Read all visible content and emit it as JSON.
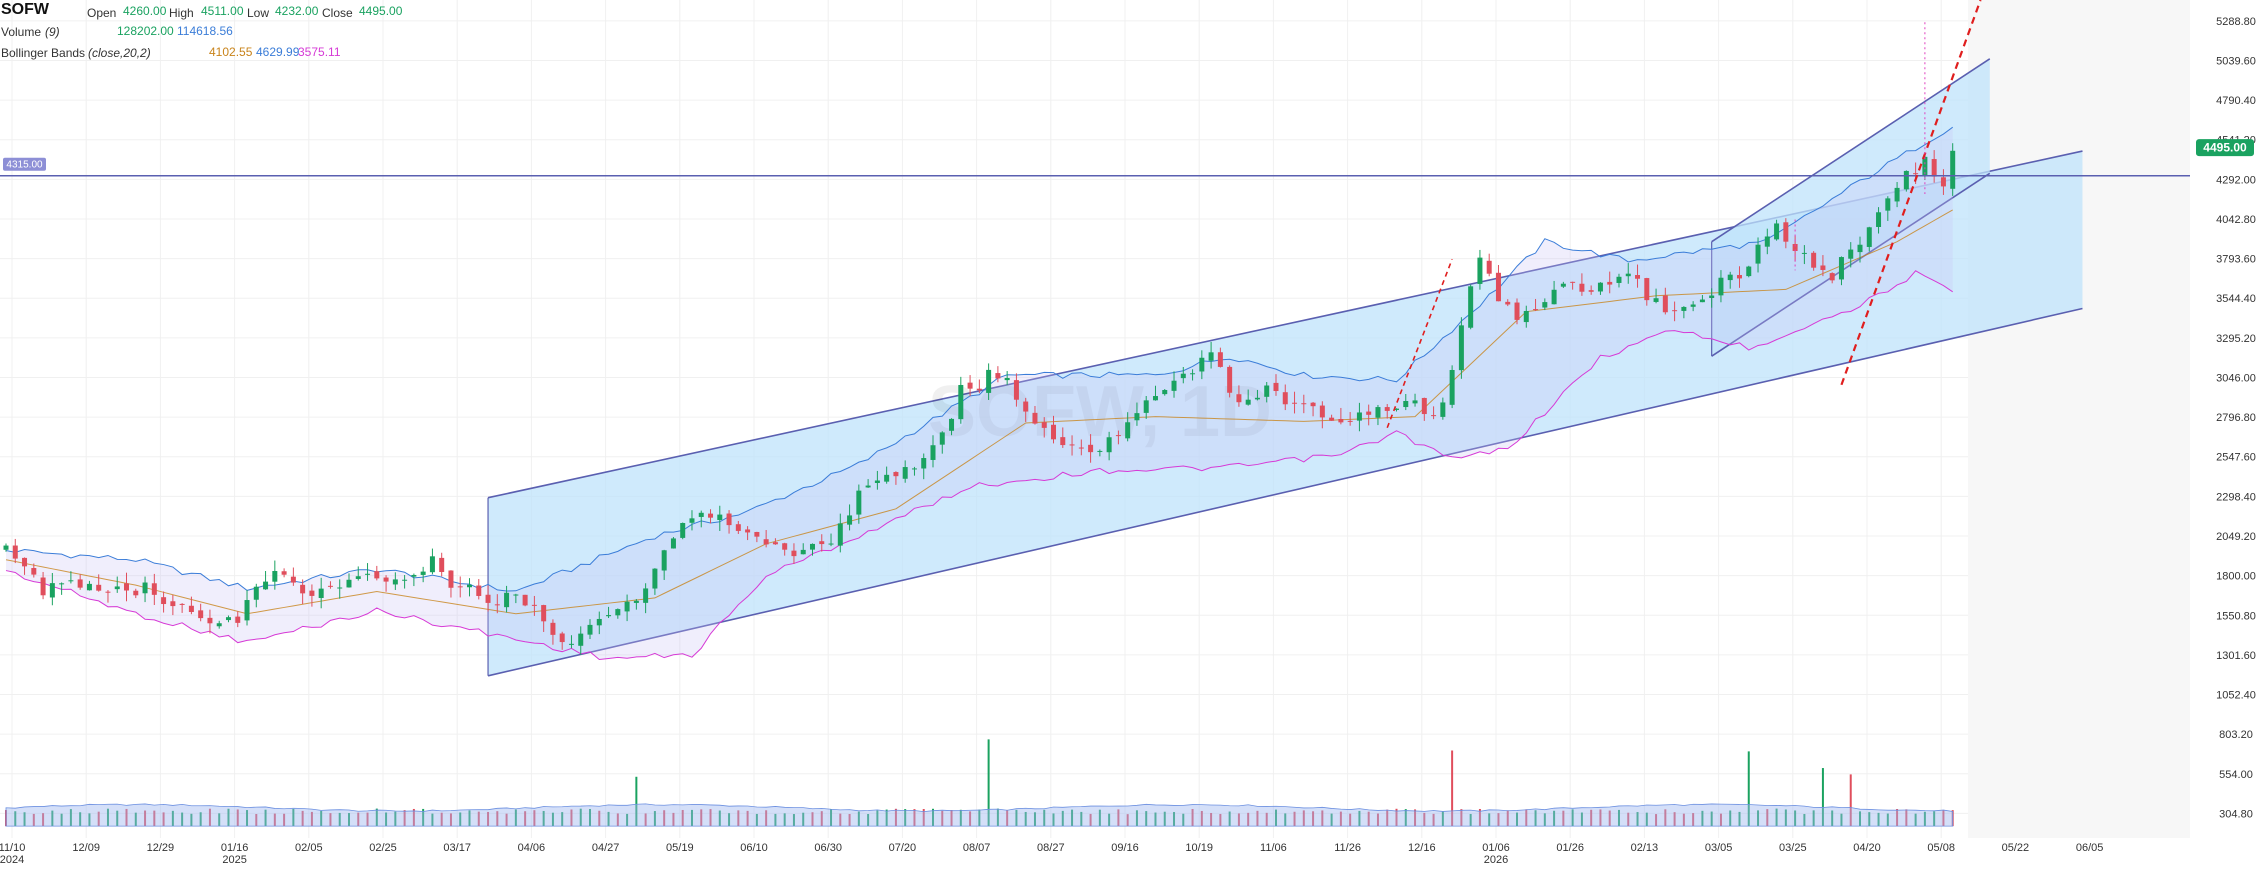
{
  "symbol": "SOFW",
  "ohlc": {
    "open_label": "Open",
    "open": "4260.00",
    "high_label": "High",
    "high": "4511.00",
    "low_label": "Low",
    "low": "4232.00",
    "close_label": "Close",
    "close": "4495.00"
  },
  "volume_legend": {
    "label": "Volume",
    "period": "(9)",
    "value": "128202.00",
    "ma": "114618.56"
  },
  "bb_legend": {
    "label": "Bollinger Bands",
    "params": "(close,20,2)",
    "basis": "4102.55",
    "upper": "4629.99",
    "lower": "3575.11"
  },
  "watermark": "SOFW, 1D",
  "left_price_tag": "4315.00",
  "last_price_tag": "4495.00",
  "colors": {
    "up": "#1aa260",
    "down": "#e04e5c",
    "grid": "#f0f0f0",
    "bb_upper": "#3b7dd8",
    "bb_lower": "#d63ad6",
    "bb_basis": "#c8831a",
    "channel_fill": "#bfe3fb",
    "channel_line": "#5a5fb0",
    "hline": "#5a5fb0",
    "vol_area": "#9fb8f0",
    "dashed_red": "#e01e1e"
  },
  "chart_data": {
    "type": "candlestick",
    "y_axis": {
      "range": [
        150,
        5420
      ],
      "ticks": [
        "5288.80",
        "5039.60",
        "4790.40",
        "4541.20",
        "4292.00",
        "4042.80",
        "3793.60",
        "3544.40",
        "3295.20",
        "3046.00",
        "2796.80",
        "2547.60",
        "2298.40",
        "2049.20",
        "1800.00",
        "1550.80",
        "1301.60",
        "1052.40",
        "803.20",
        "554.00",
        "304.80"
      ]
    },
    "x_axis": {
      "ticks": [
        {
          "label": "11/10",
          "sub": "2024"
        },
        {
          "label": "12/09",
          "sub": ""
        },
        {
          "label": "12/29",
          "sub": ""
        },
        {
          "label": "01/16",
          "sub": "2025"
        },
        {
          "label": "02/05",
          "sub": ""
        },
        {
          "label": "02/25",
          "sub": ""
        },
        {
          "label": "03/17",
          "sub": ""
        },
        {
          "label": "04/06",
          "sub": ""
        },
        {
          "label": "04/27",
          "sub": ""
        },
        {
          "label": "05/19",
          "sub": ""
        },
        {
          "label": "06/10",
          "sub": ""
        },
        {
          "label": "06/30",
          "sub": ""
        },
        {
          "label": "07/20",
          "sub": ""
        },
        {
          "label": "08/07",
          "sub": ""
        },
        {
          "label": "08/27",
          "sub": ""
        },
        {
          "label": "09/16",
          "sub": ""
        },
        {
          "label": "10/19",
          "sub": ""
        },
        {
          "label": "11/06",
          "sub": ""
        },
        {
          "label": "11/26",
          "sub": ""
        },
        {
          "label": "12/16",
          "sub": ""
        },
        {
          "label": "01/06",
          "sub": "2026"
        },
        {
          "label": "01/26",
          "sub": ""
        },
        {
          "label": "02/13",
          "sub": ""
        },
        {
          "label": "03/05",
          "sub": ""
        },
        {
          "label": "03/25",
          "sub": ""
        },
        {
          "label": "04/20",
          "sub": ""
        },
        {
          "label": "05/08",
          "sub": ""
        },
        {
          "label": "05/22",
          "sub": ""
        },
        {
          "label": "06/05",
          "sub": ""
        }
      ]
    },
    "price_path": [
      [
        0,
        1960
      ],
      [
        2,
        1850
      ],
      [
        4,
        1700
      ],
      [
        6,
        1740
      ],
      [
        9,
        1760
      ],
      [
        12,
        1700
      ],
      [
        15,
        1720
      ],
      [
        18,
        1600
      ],
      [
        21,
        1530
      ],
      [
        23,
        1480
      ],
      [
        25,
        1540
      ],
      [
        27,
        1720
      ],
      [
        29,
        1790
      ],
      [
        31,
        1760
      ],
      [
        33,
        1700
      ],
      [
        35,
        1690
      ],
      [
        38,
        1760
      ],
      [
        41,
        1780
      ],
      [
        44,
        1800
      ],
      [
        46,
        1880
      ],
      [
        48,
        1760
      ],
      [
        50,
        1700
      ],
      [
        52,
        1640
      ],
      [
        55,
        1660
      ],
      [
        57,
        1580
      ],
      [
        59,
        1450
      ],
      [
        61,
        1360
      ],
      [
        63,
        1460
      ],
      [
        65,
        1540
      ],
      [
        67,
        1600
      ],
      [
        69,
        1760
      ],
      [
        71,
        1920
      ],
      [
        73,
        2100
      ],
      [
        75,
        2220
      ],
      [
        77,
        2160
      ],
      [
        79,
        2060
      ],
      [
        81,
        2070
      ],
      [
        83,
        2000
      ],
      [
        85,
        1950
      ],
      [
        87,
        1990
      ],
      [
        89,
        2040
      ],
      [
        91,
        2220
      ],
      [
        93,
        2360
      ],
      [
        95,
        2420
      ],
      [
        97,
        2480
      ],
      [
        99,
        2520
      ],
      [
        101,
        2660
      ],
      [
        103,
        2980
      ],
      [
        105,
        3000
      ],
      [
        106,
        3130
      ],
      [
        108,
        3000
      ],
      [
        110,
        2820
      ],
      [
        112,
        2700
      ],
      [
        114,
        2650
      ],
      [
        116,
        2580
      ],
      [
        118,
        2600
      ],
      [
        120,
        2690
      ],
      [
        122,
        2810
      ],
      [
        124,
        2910
      ],
      [
        126,
        3000
      ],
      [
        128,
        3080
      ],
      [
        130,
        3230
      ],
      [
        132,
        2960
      ],
      [
        134,
        2900
      ],
      [
        136,
        2960
      ],
      [
        138,
        2880
      ],
      [
        140,
        2860
      ],
      [
        142,
        2810
      ],
      [
        144,
        2760
      ],
      [
        146,
        2790
      ],
      [
        148,
        2850
      ],
      [
        150,
        2880
      ],
      [
        152,
        2940
      ],
      [
        154,
        2760
      ],
      [
        156,
        3100
      ],
      [
        157,
        3400
      ],
      [
        158,
        3580
      ],
      [
        159,
        3760
      ],
      [
        161,
        3560
      ],
      [
        163,
        3440
      ],
      [
        165,
        3490
      ],
      [
        167,
        3580
      ],
      [
        169,
        3620
      ],
      [
        171,
        3560
      ],
      [
        173,
        3640
      ],
      [
        175,
        3720
      ],
      [
        177,
        3540
      ],
      [
        179,
        3480
      ],
      [
        181,
        3450
      ],
      [
        183,
        3520
      ],
      [
        185,
        3640
      ],
      [
        187,
        3700
      ],
      [
        189,
        3850
      ],
      [
        191,
        3980
      ],
      [
        193,
        3820
      ],
      [
        195,
        3750
      ],
      [
        197,
        3700
      ],
      [
        199,
        3820
      ],
      [
        201,
        4020
      ],
      [
        203,
        4170
      ],
      [
        205,
        4300
      ],
      [
        207,
        4420
      ],
      [
        209,
        4260
      ],
      [
        210,
        4495
      ]
    ],
    "volume_spikes": [
      [
        68,
        235
      ],
      [
        106,
        470
      ],
      [
        156,
        400
      ],
      [
        188,
        395
      ],
      [
        196,
        290
      ],
      [
        199,
        250
      ]
    ],
    "bollinger": {
      "upper_path": [
        [
          0,
          1960
        ],
        [
          14,
          1900
        ],
        [
          26,
          1720
        ],
        [
          40,
          1840
        ],
        [
          55,
          1700
        ],
        [
          70,
          2050
        ],
        [
          80,
          2200
        ],
        [
          92,
          2500
        ],
        [
          108,
          3060
        ],
        [
          124,
          3060
        ],
        [
          132,
          3180
        ],
        [
          140,
          3060
        ],
        [
          150,
          3030
        ],
        [
          160,
          3560
        ],
        [
          166,
          3900
        ],
        [
          175,
          3780
        ],
        [
          190,
          3900
        ],
        [
          200,
          4280
        ],
        [
          210,
          4630
        ]
      ],
      "lower_path": [
        [
          0,
          1830
        ],
        [
          14,
          1560
        ],
        [
          26,
          1380
        ],
        [
          40,
          1580
        ],
        [
          55,
          1400
        ],
        [
          65,
          1280
        ],
        [
          74,
          1300
        ],
        [
          82,
          1800
        ],
        [
          92,
          2050
        ],
        [
          104,
          2360
        ],
        [
          118,
          2460
        ],
        [
          132,
          2480
        ],
        [
          144,
          2560
        ],
        [
          150,
          2700
        ],
        [
          156,
          2530
        ],
        [
          162,
          2600
        ],
        [
          172,
          3170
        ],
        [
          180,
          3350
        ],
        [
          188,
          3230
        ],
        [
          200,
          3500
        ],
        [
          206,
          3700
        ],
        [
          210,
          3575
        ]
      ],
      "basis_path": [
        [
          0,
          1900
        ],
        [
          14,
          1740
        ],
        [
          26,
          1560
        ],
        [
          40,
          1700
        ],
        [
          55,
          1560
        ],
        [
          70,
          1660
        ],
        [
          82,
          2000
        ],
        [
          96,
          2220
        ],
        [
          110,
          2760
        ],
        [
          124,
          2800
        ],
        [
          140,
          2770
        ],
        [
          152,
          2800
        ],
        [
          164,
          3460
        ],
        [
          178,
          3560
        ],
        [
          192,
          3600
        ],
        [
          204,
          3900
        ],
        [
          210,
          4100
        ]
      ]
    },
    "annotations": {
      "big_channel": {
        "top_start": [
          52,
          2290
        ],
        "top_end": [
          224,
          4470
        ],
        "bot_start": [
          52,
          1170
        ],
        "bot_end": [
          224,
          3480
        ]
      },
      "small_channel": {
        "top_start": [
          184,
          3900
        ],
        "top_end": [
          214,
          5050
        ],
        "bot_start": [
          184,
          3180
        ],
        "bot_end": [
          214,
          4330
        ]
      },
      "horizontal_line_price": 4315,
      "dashed_red": [
        [
          198,
          3000
        ],
        [
          213,
          5420
        ]
      ],
      "dashed_red_early": [
        [
          149,
          2730
        ],
        [
          156,
          3790
        ]
      ]
    }
  }
}
